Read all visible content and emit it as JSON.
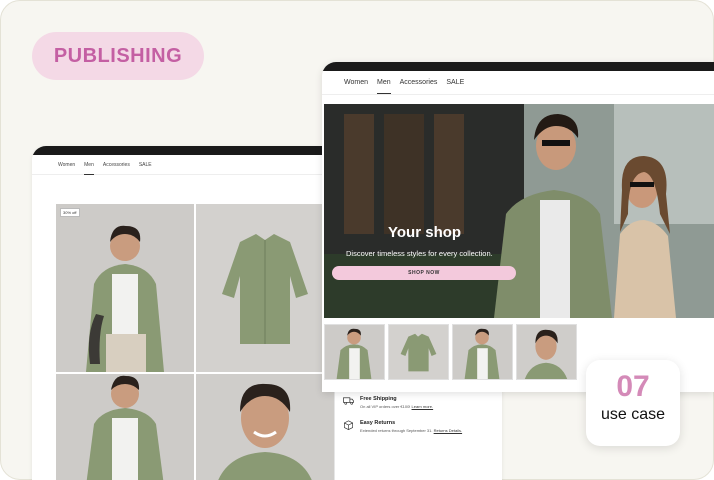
{
  "header": {
    "pill_label": "PUBLISHING"
  },
  "back_window": {
    "nav": [
      "Women",
      "Men",
      "Accessories",
      "SALE"
    ],
    "active_nav": "Men",
    "badge": "30% off",
    "info": [
      {
        "title": "Free Shipping",
        "text": "On all VIP orders over €100!",
        "link": "Learn more."
      },
      {
        "title": "Easy Returns",
        "text": "Extended returns through September 31.",
        "link": "Returns Details."
      }
    ]
  },
  "front_window": {
    "nav": [
      "Women",
      "Men",
      "Accessories",
      "SALE"
    ],
    "active_nav": "Men",
    "hero": {
      "title": "Your shop",
      "subtitle": "Discover timeless styles for every collection.",
      "button": "SHOP NOW"
    }
  },
  "usecase": {
    "number": "07",
    "label": "use case"
  },
  "colors": {
    "accent_pink": "#f4d9e6",
    "accent_text": "#c45fa3",
    "number_pink": "#d48ab8",
    "shirt_green": "#8a9a74"
  }
}
